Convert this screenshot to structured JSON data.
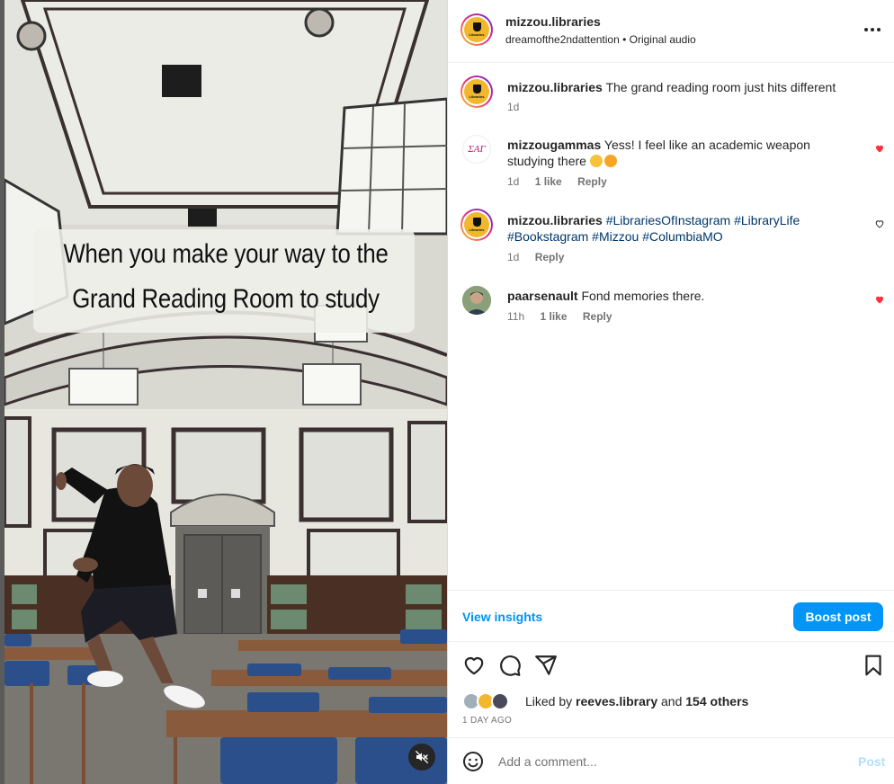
{
  "media": {
    "caption_line1": "When you make your way to the",
    "caption_line2": "Grand Reading Room to study",
    "mute_icon": "speaker-muted-icon"
  },
  "header": {
    "username": "mizzou.libraries",
    "subtitle": "dreamofthe2ndattention • Original audio",
    "avatar_label": "Libraries",
    "more_icon": "more-horizontal-icon"
  },
  "comments": [
    {
      "username": "mizzou.libraries",
      "text": "The grand reading room just hits different",
      "time": "1d",
      "likes": "",
      "reply": ""
    },
    {
      "username": "mizzougammas",
      "text": "Yess! I feel like an academic weapon studying there",
      "time": "1d",
      "likes": "1 like",
      "reply": "Reply",
      "avatar_text": "ΣΑΓ",
      "liked": true
    },
    {
      "username": "mizzou.libraries",
      "tags": [
        "#LibrariesOfInstagram",
        "#LibraryLife",
        "#Bookstagram",
        "#Mizzou",
        "#ColumbiaMO"
      ],
      "time": "1d",
      "likes": "",
      "reply": "Reply",
      "liked": false
    },
    {
      "username": "paarsenault",
      "text": "Fond memories there.",
      "time": "11h",
      "likes": "1 like",
      "reply": "Reply",
      "liked": true
    }
  ],
  "insights": {
    "view_label": "View insights",
    "boost_label": "Boost post"
  },
  "actions": {
    "like_icon": "heart-icon",
    "comment_icon": "comment-icon",
    "share_icon": "share-icon",
    "save_icon": "bookmark-icon"
  },
  "likes": {
    "prefix": "Liked by ",
    "user": "reeves.library",
    "middle": " and ",
    "others": "154 others"
  },
  "date": "1 DAY AGO",
  "comment_box": {
    "placeholder": "Add a comment...",
    "post_label": "Post",
    "emoji_icon": "emoji-smile-icon"
  },
  "colors": {
    "accent": "#0095f6",
    "heart": "#ff3040",
    "gold": "#f1b82d"
  }
}
